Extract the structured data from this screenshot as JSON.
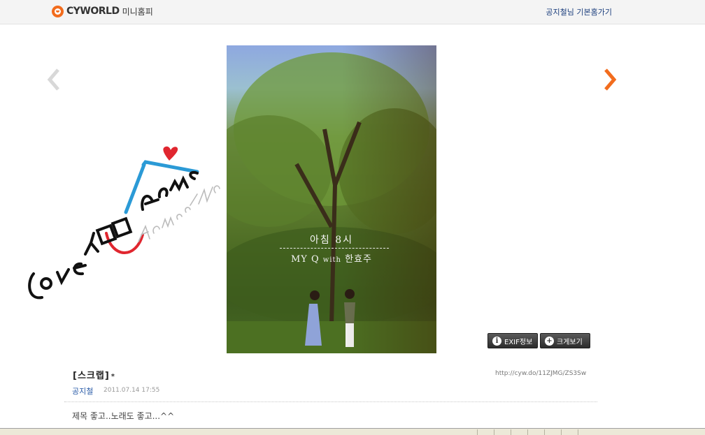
{
  "header": {
    "brand": "CYWORLD",
    "sub": "미니홈피",
    "home_link": "공지철님 기본홈가기"
  },
  "nav": {
    "prev_icon": "chevron-left-icon",
    "next_icon": "chevron-right-icon"
  },
  "photo": {
    "title_line1": "아침 8시",
    "title_line2_main": "MY Q",
    "title_line2_with": "with",
    "title_line2_artist": "한효주"
  },
  "buttons": {
    "exif_label": "EXIF정보",
    "zoom_label": "크게보기"
  },
  "post": {
    "title": "[스크랩]",
    "title_mark": "*",
    "url": "http://cyw.do/11ZJMG/ZS3Sw",
    "author": "공지철",
    "date": "2011.07.14 17:55",
    "body": "제목 좋고..노래도 좋고...^^"
  },
  "colors": {
    "accent": "#f26c1d",
    "link": "#2b5ca8",
    "arrow_next": "#f26c1d",
    "arrow_prev": "#d8d8d8"
  }
}
